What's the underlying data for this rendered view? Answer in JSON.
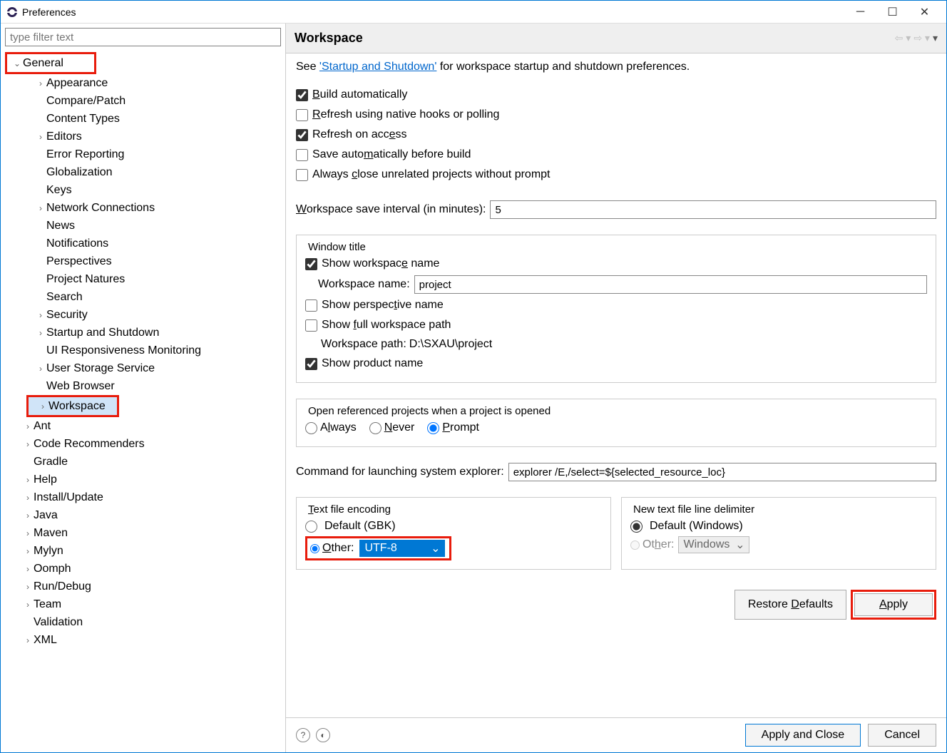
{
  "titlebar": {
    "title": "Preferences"
  },
  "filter": {
    "placeholder": "type filter text"
  },
  "tree": {
    "general": "General",
    "appearance": "Appearance",
    "compare_patch": "Compare/Patch",
    "content_types": "Content Types",
    "editors": "Editors",
    "error_reporting": "Error Reporting",
    "globalization": "Globalization",
    "keys": "Keys",
    "network": "Network Connections",
    "news": "News",
    "notifications": "Notifications",
    "perspectives": "Perspectives",
    "project_natures": "Project Natures",
    "search": "Search",
    "security": "Security",
    "startup": "Startup and Shutdown",
    "ui_resp": "UI Responsiveness Monitoring",
    "user_storage": "User Storage Service",
    "web_browser": "Web Browser",
    "workspace": "Workspace",
    "ant": "Ant",
    "code_rec": "Code Recommenders",
    "gradle": "Gradle",
    "help": "Help",
    "install_update": "Install/Update",
    "java": "Java",
    "maven": "Maven",
    "mylyn": "Mylyn",
    "oomph": "Oomph",
    "run_debug": "Run/Debug",
    "team": "Team",
    "validation": "Validation",
    "xml": "XML"
  },
  "header": {
    "title": "Workspace"
  },
  "intro": {
    "see": "See ",
    "link": "'Startup and Shutdown'",
    "rest": " for workspace startup and shutdown preferences."
  },
  "checks": {
    "build_auto": "Build automatically",
    "refresh_native": "Refresh using native hooks or polling",
    "refresh_access": "Refresh on access",
    "save_before_build": "Save automatically before build",
    "close_unrelated": "Always close unrelated projects without prompt"
  },
  "save_interval": {
    "label": "Workspace save interval (in minutes):",
    "value": "5"
  },
  "window_title": {
    "legend": "Window title",
    "show_ws_name": "Show workspace name",
    "ws_name_label": "Workspace name:",
    "ws_name_value": "project",
    "show_perspective": "Show perspective name",
    "show_full_path": "Show full workspace path",
    "ws_path_label": "Workspace path:",
    "ws_path_value": "D:\\SXAU\\project",
    "show_product": "Show product name"
  },
  "open_ref": {
    "legend": "Open referenced projects when a project is opened",
    "always": "Always",
    "never": "Never",
    "prompt": "Prompt"
  },
  "explorer": {
    "label": "Command for launching system explorer:",
    "value": "explorer /E,/select=${selected_resource_loc}"
  },
  "encoding": {
    "legend": "Text file encoding",
    "default": "Default (GBK)",
    "other": "Other:",
    "value": "UTF-8"
  },
  "delimiter": {
    "legend": "New text file line delimiter",
    "default": "Default (Windows)",
    "other": "Other:",
    "value": "Windows"
  },
  "buttons": {
    "restore": "Restore Defaults",
    "apply": "Apply",
    "apply_close": "Apply and Close",
    "cancel": "Cancel"
  }
}
